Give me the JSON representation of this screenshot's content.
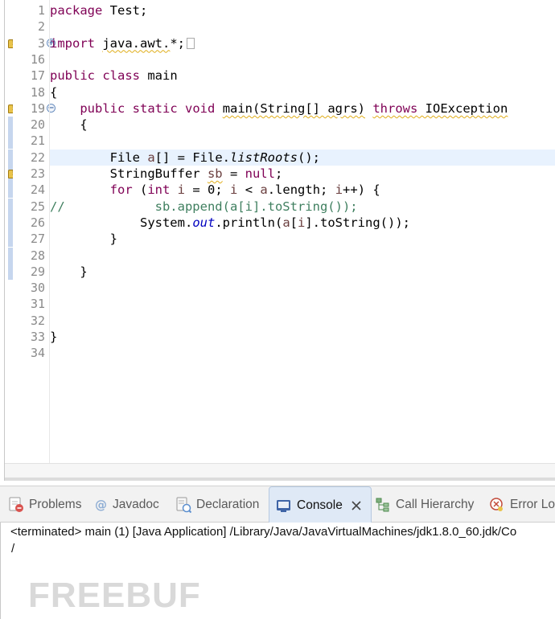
{
  "editor": {
    "lines": [
      {
        "num": "1",
        "tokens": [
          {
            "t": "package",
            "c": "kw"
          },
          {
            "t": " Test;"
          }
        ]
      },
      {
        "num": "2",
        "tokens": []
      },
      {
        "num": "3",
        "marker": "warning",
        "fold": "expand",
        "tokens": [
          {
            "t": "import",
            "c": "kw"
          },
          {
            "t": " "
          },
          {
            "t": "java.awt.",
            "c": "wv"
          },
          {
            "t": "*;"
          },
          {
            "box": true
          }
        ]
      },
      {
        "num": "16",
        "tokens": []
      },
      {
        "num": "17",
        "tokens": [
          {
            "t": "public",
            "c": "kw"
          },
          {
            "t": " "
          },
          {
            "t": "class",
            "c": "kw"
          },
          {
            "t": " main"
          }
        ]
      },
      {
        "num": "18",
        "tokens": [
          {
            "t": "{"
          }
        ]
      },
      {
        "num": "19",
        "marker": "warning",
        "fold": "collapse",
        "tokens": [
          {
            "t": "    "
          },
          {
            "t": "public",
            "c": "kw"
          },
          {
            "t": " "
          },
          {
            "t": "static",
            "c": "kw"
          },
          {
            "t": " "
          },
          {
            "t": "void",
            "c": "kw"
          },
          {
            "t": " "
          },
          {
            "t": "main(String[] agrs)",
            "c": "wv"
          },
          {
            "t": " "
          },
          {
            "t": "throws",
            "c": "kw wv"
          },
          {
            "t": " IOException",
            "c": "wv"
          }
        ]
      },
      {
        "num": "20",
        "changed": true,
        "tokens": [
          {
            "t": "    {"
          }
        ]
      },
      {
        "num": "21",
        "changed": true,
        "tokens": []
      },
      {
        "num": "22",
        "changed": true,
        "current": true,
        "tokens": [
          {
            "t": "        File "
          },
          {
            "t": "a",
            "c": "var"
          },
          {
            "t": "[] = File."
          },
          {
            "t": "listRoots",
            "c": "itl"
          },
          {
            "t": "();"
          }
        ]
      },
      {
        "num": "23",
        "marker": "warning",
        "changed": true,
        "tokens": [
          {
            "t": "        StringBuffer "
          },
          {
            "t": "sb",
            "c": "var wv"
          },
          {
            "t": " = "
          },
          {
            "t": "null",
            "c": "kw"
          },
          {
            "t": ";"
          }
        ]
      },
      {
        "num": "24",
        "changed": true,
        "tokens": [
          {
            "t": "        "
          },
          {
            "t": "for",
            "c": "kw"
          },
          {
            "t": " ("
          },
          {
            "t": "int",
            "c": "kw"
          },
          {
            "t": " "
          },
          {
            "t": "i",
            "c": "var"
          },
          {
            "t": " = 0; "
          },
          {
            "t": "i",
            "c": "var"
          },
          {
            "t": " < "
          },
          {
            "t": "a",
            "c": "var"
          },
          {
            "t": ".length; "
          },
          {
            "t": "i",
            "c": "var"
          },
          {
            "t": "++) {"
          }
        ]
      },
      {
        "num": "25",
        "changed": true,
        "tokens": [
          {
            "t": "//            sb.append(a[i].toString());",
            "c": "cm"
          }
        ]
      },
      {
        "num": "26",
        "changed": true,
        "tokens": [
          {
            "t": "            System."
          },
          {
            "t": "out",
            "c": "fld"
          },
          {
            "t": ".println("
          },
          {
            "t": "a",
            "c": "var"
          },
          {
            "t": "["
          },
          {
            "t": "i",
            "c": "var"
          },
          {
            "t": "].toString());"
          }
        ]
      },
      {
        "num": "27",
        "changed": true,
        "tokens": [
          {
            "t": "        }"
          }
        ]
      },
      {
        "num": "28",
        "changed": true,
        "tokens": []
      },
      {
        "num": "29",
        "changed": true,
        "tokens": [
          {
            "t": "    }"
          }
        ]
      },
      {
        "num": "30",
        "tokens": []
      },
      {
        "num": "31",
        "tokens": []
      },
      {
        "num": "32",
        "tokens": []
      },
      {
        "num": "33",
        "tokens": [
          {
            "t": "}"
          }
        ]
      },
      {
        "num": "34",
        "tokens": []
      }
    ]
  },
  "tabs": {
    "problems": "Problems",
    "javadoc": "Javadoc",
    "declaration": "Declaration",
    "console": "Console",
    "call_hierarchy": "Call Hierarchy",
    "error_log": "Error Lo"
  },
  "console": {
    "status": "<terminated> main (1) [Java Application] /Library/Java/JavaVirtualMachines/jdk1.8.0_60.jdk/Co",
    "output": "/"
  },
  "watermark": "FREEBUF",
  "colors": {
    "keyword": "#7f0055",
    "comment": "#3f7f5f",
    "field": "#0000c0",
    "current_line": "#e8f2fe",
    "warning": "#e9c34a"
  }
}
